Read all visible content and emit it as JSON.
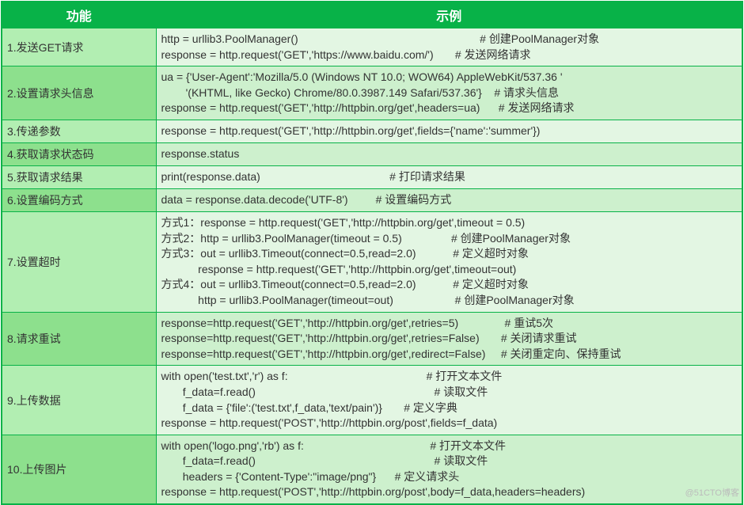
{
  "header": {
    "col1": "功能",
    "col2": "示例"
  },
  "rows": [
    {
      "shade": "dark",
      "func": "1.发送GET请求",
      "example": "http = urllib3.PoolManager()                                                           # 创建PoolManager对象\nresponse = http.request('GET','https://www.baidu.com/')       # 发送网络请求"
    },
    {
      "shade": "light",
      "func": "2.设置请求头信息",
      "example": "ua = {'User-Agent':'Mozilla/5.0 (Windows NT 10.0; WOW64) AppleWebKit/537.36 '\n        '(KHTML, like Gecko) Chrome/80.0.3987.149 Safari/537.36'}    # 请求头信息\nresponse = http.request('GET','http://httpbin.org/get',headers=ua)      # 发送网络请求"
    },
    {
      "shade": "dark",
      "func": "3.传递参数",
      "example": "response = http.request('GET','http://httpbin.org/get',fields={'name':'summer'})"
    },
    {
      "shade": "light",
      "func": "4.获取请求状态码",
      "example": "response.status"
    },
    {
      "shade": "dark",
      "func": "5.获取请求结果",
      "example": "print(response.data)                                          # 打印请求结果"
    },
    {
      "shade": "light",
      "func": "6.设置编码方式",
      "example": "data = response.data.decode('UTF-8')         # 设置编码方式"
    },
    {
      "shade": "dark",
      "func": "7.设置超时",
      "example": "方式1：response = http.request('GET','http://httpbin.org/get',timeout = 0.5)\n方式2：http = urllib3.PoolManager(timeout = 0.5)                # 创建PoolManager对象\n方式3：out = urllib3.Timeout(connect=0.5,read=2.0)            # 定义超时对象\n            response = http.request('GET','http://httpbin.org/get',timeout=out)\n方式4：out = urllib3.Timeout(connect=0.5,read=2.0)            # 定义超时对象\n            http = urllib3.PoolManager(timeout=out)                    # 创建PoolManager对象"
    },
    {
      "shade": "light",
      "func": "8.请求重试",
      "example": "response=http.request('GET','http://httpbin.org/get',retries=5)               # 重试5次\nresponse=http.request('GET','http://httpbin.org/get',retries=False)       # 关闭请求重试\nresponse=http.request('GET','http://httpbin.org/get',redirect=False)     # 关闭重定向、保持重试"
    },
    {
      "shade": "dark",
      "func": "9.上传数据",
      "example": "with open('test.txt','r') as f:                                             # 打开文本文件\n       f_data=f.read()                                                          # 读取文件\n       f_data = {'file':('test.txt',f_data,'text/pain')}       # 定义字典\nresponse = http.request('POST','http://httpbin.org/post',fields=f_data)"
    },
    {
      "shade": "light",
      "func": "10.上传图片",
      "example": "with open('logo.png','rb') as f:                                         # 打开文本文件\n       f_data=f.read()                                                          # 读取文件\n       headers = {'Content-Type':\"image/png\"}      # 定义请求头\nresponse = http.request('POST','http://httpbin.org/post',body=f_data,headers=headers)"
    }
  ],
  "watermark": "@51CTO博客"
}
